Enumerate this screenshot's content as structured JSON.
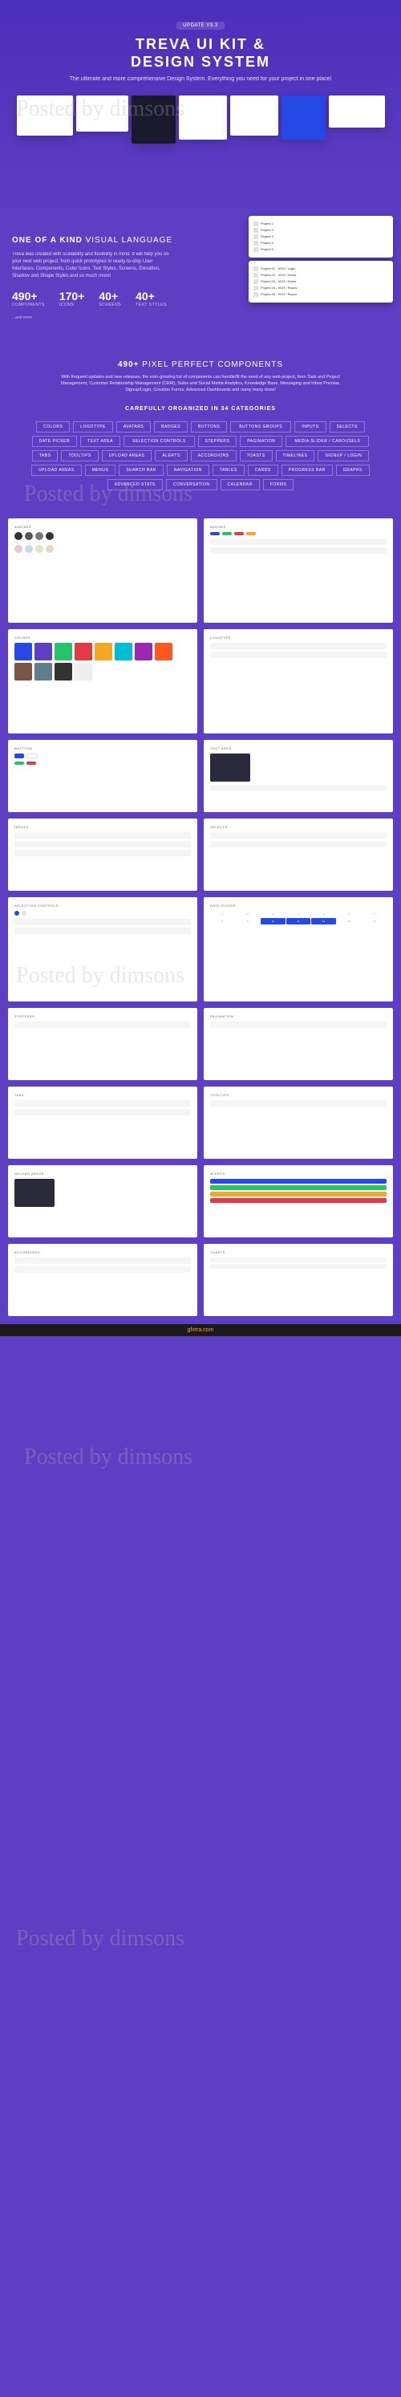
{
  "hero": {
    "badge": "UPDATE V3.3",
    "title_line1": "TREVA UI KIT &",
    "title_line2": "DESIGN SYSTEM",
    "subtitle": "The ultimate and more comprehensive Design System.\nEverything you need for your project in one place!"
  },
  "visual_lang": {
    "title_bold": "ONE OF A KIND",
    "title_thin": "VISUAL LANGUAGE",
    "desc": "Treva was created with scalability and flexibility in mind. It will help you on your next web project, from quick prototypes to ready-to-ship User Interfaces.\n\nComponents, Color Icons, Text Styles, Screens, Elevation, Shadow and Shape Styles and so much more!",
    "stats": [
      {
        "num": "490+",
        "label": "COMPONENTS"
      },
      {
        "num": "170+",
        "label": "ICONS"
      },
      {
        "num": "40+",
        "label": "SCREENS"
      },
      {
        "num": "40+",
        "label": "TEXT STYLES"
      }
    ],
    "more": "...and more",
    "side_items": [
      "Project 1",
      "Project 2",
      "Project 3",
      "Project 4",
      "Project 5"
    ],
    "file_items": [
      "Project 01 - HCH / Login",
      "Project 02 - HCH / Home",
      "Project 03 - HCH / Home",
      "Project 04 - HCH / Repos",
      "Project 05 - HCH / Repos"
    ]
  },
  "components": {
    "title_num": "490+",
    "title_thin": "PIXEL PERFECT COMPONENTS",
    "desc": "With frequent updates and new releases, the ever-growing list of components can handle/fit the need of any web project, from Task and Project Management, Customer Relationship Management (CRM), Sales and Social Media Analytics, Knowledge Base, Messaging and Inbox Preview, Signup/Login, Creation Forms, Advanced Dashboards and many many more!",
    "cat_label": "CAREFULLY ORGANIZED IN 34 CATEGORIES",
    "categories": [
      "COLORS",
      "LOGOTYPE",
      "AVATARS",
      "BADGES",
      "BUTTONS",
      "BUTTONS GROUPS",
      "INPUTS",
      "SELECTS",
      "DATE PICKER",
      "TEXT AREA",
      "SELECTION CONTROLS",
      "STEPPERS",
      "PAGINATION",
      "MEDIA SLIDER / CAROUSELS",
      "TABS",
      "TOOLTIPS",
      "UPLOAD AREAS",
      "ALERTS",
      "ACCORDIONS",
      "TOASTS",
      "TIMELINES",
      "SIGNUP / LOGIN",
      "UPLOAD AREAS",
      "MENUS",
      "SEARCH BAR",
      "NAVIGATION",
      "TABLES",
      "CARDS",
      "PROGRESS BAR",
      "GRAPHS",
      "ADVANCED STATS",
      "CONVERSATION",
      "CALENDAR",
      "FORMS"
    ]
  },
  "previews": {
    "avatars": "AVATARS",
    "badges": "BADGES",
    "colors": "COLORS",
    "logotype": "LOGOTYPE",
    "buttons": "BUTTONS",
    "inputs": "INPUTS",
    "selects": "SELECTS",
    "textarea": "TEXT AREA",
    "datepicker": "DATE PICKER",
    "steppers": "STEPPERS",
    "pagination": "PAGINATION",
    "tabs": "TABS",
    "tooltips": "TOOLTIPS",
    "alerts": "ALERTS",
    "accordions": "ACCORDIONS",
    "toasts": "TOASTS",
    "upload": "UPLOAD AREAS",
    "selection": "SELECTION CONTROLS"
  },
  "colors": {
    "primary": "#2548e6",
    "purple": "#5d3fc4",
    "green": "#25c46b",
    "red": "#e63946",
    "yellow": "#f5a623",
    "dark": "#2a2a3a"
  },
  "footer": {
    "url": "gfxtra.com"
  },
  "watermark": "Posted by dimsons"
}
